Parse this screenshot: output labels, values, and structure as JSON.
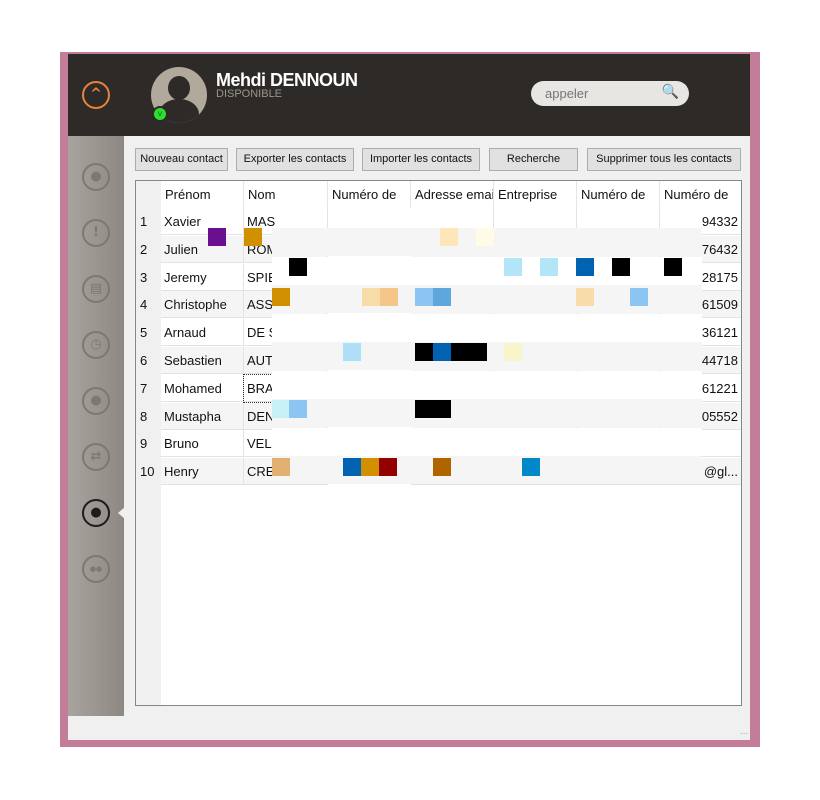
{
  "header": {
    "user_name": "Mehdi DENNOUN",
    "status": "DISPONIBLE",
    "search_placeholder": "appeler"
  },
  "toolbar": {
    "buttons": [
      "Nouveau contact",
      "Exporter les contacts",
      "Importer les contacts",
      "Recherche",
      "Supprimer tous les contacts"
    ]
  },
  "table": {
    "columns": [
      "Prénom",
      "Nom",
      "Numéro de",
      "Adresse email",
      "Entreprise",
      "Numéro de",
      "Numéro de"
    ],
    "rows": [
      {
        "n": "1",
        "prenom": "Xavier",
        "nom": "MAS",
        "last": "94332"
      },
      {
        "n": "2",
        "prenom": "Julien",
        "nom": "ROM",
        "last": "76432"
      },
      {
        "n": "3",
        "prenom": "Jeremy",
        "nom": "SPIE",
        "last": "28175"
      },
      {
        "n": "4",
        "prenom": "Christophe",
        "nom": "ASS",
        "last": "61509"
      },
      {
        "n": "5",
        "prenom": "Arnaud",
        "nom": "DE S",
        "last": "36121"
      },
      {
        "n": "6",
        "prenom": "Sebastien",
        "nom": "AUT",
        "last": "44718"
      },
      {
        "n": "7",
        "prenom": "Mohamed",
        "nom": "BRA",
        "last": "61221"
      },
      {
        "n": "8",
        "prenom": "Mustapha",
        "nom": "DEN",
        "last": "05552"
      },
      {
        "n": "9",
        "prenom": "Bruno",
        "nom": "VEL",
        "last": ""
      },
      {
        "n": "10",
        "prenom": "Henry",
        "nom": "CRE",
        "last": "@gl..."
      }
    ]
  },
  "sidebar": {
    "icons": [
      "contact-icon",
      "alert-icon",
      "printer-icon",
      "clock-icon",
      "user-icon",
      "transfer-icon",
      "contacts-active-icon",
      "group-icon"
    ],
    "active_index": 6
  },
  "colors": {
    "header_bg": "#2e2a27",
    "accent_orange": "#e8823e",
    "status_green": "#2ee02e",
    "frame_pink": "#c47d99"
  }
}
